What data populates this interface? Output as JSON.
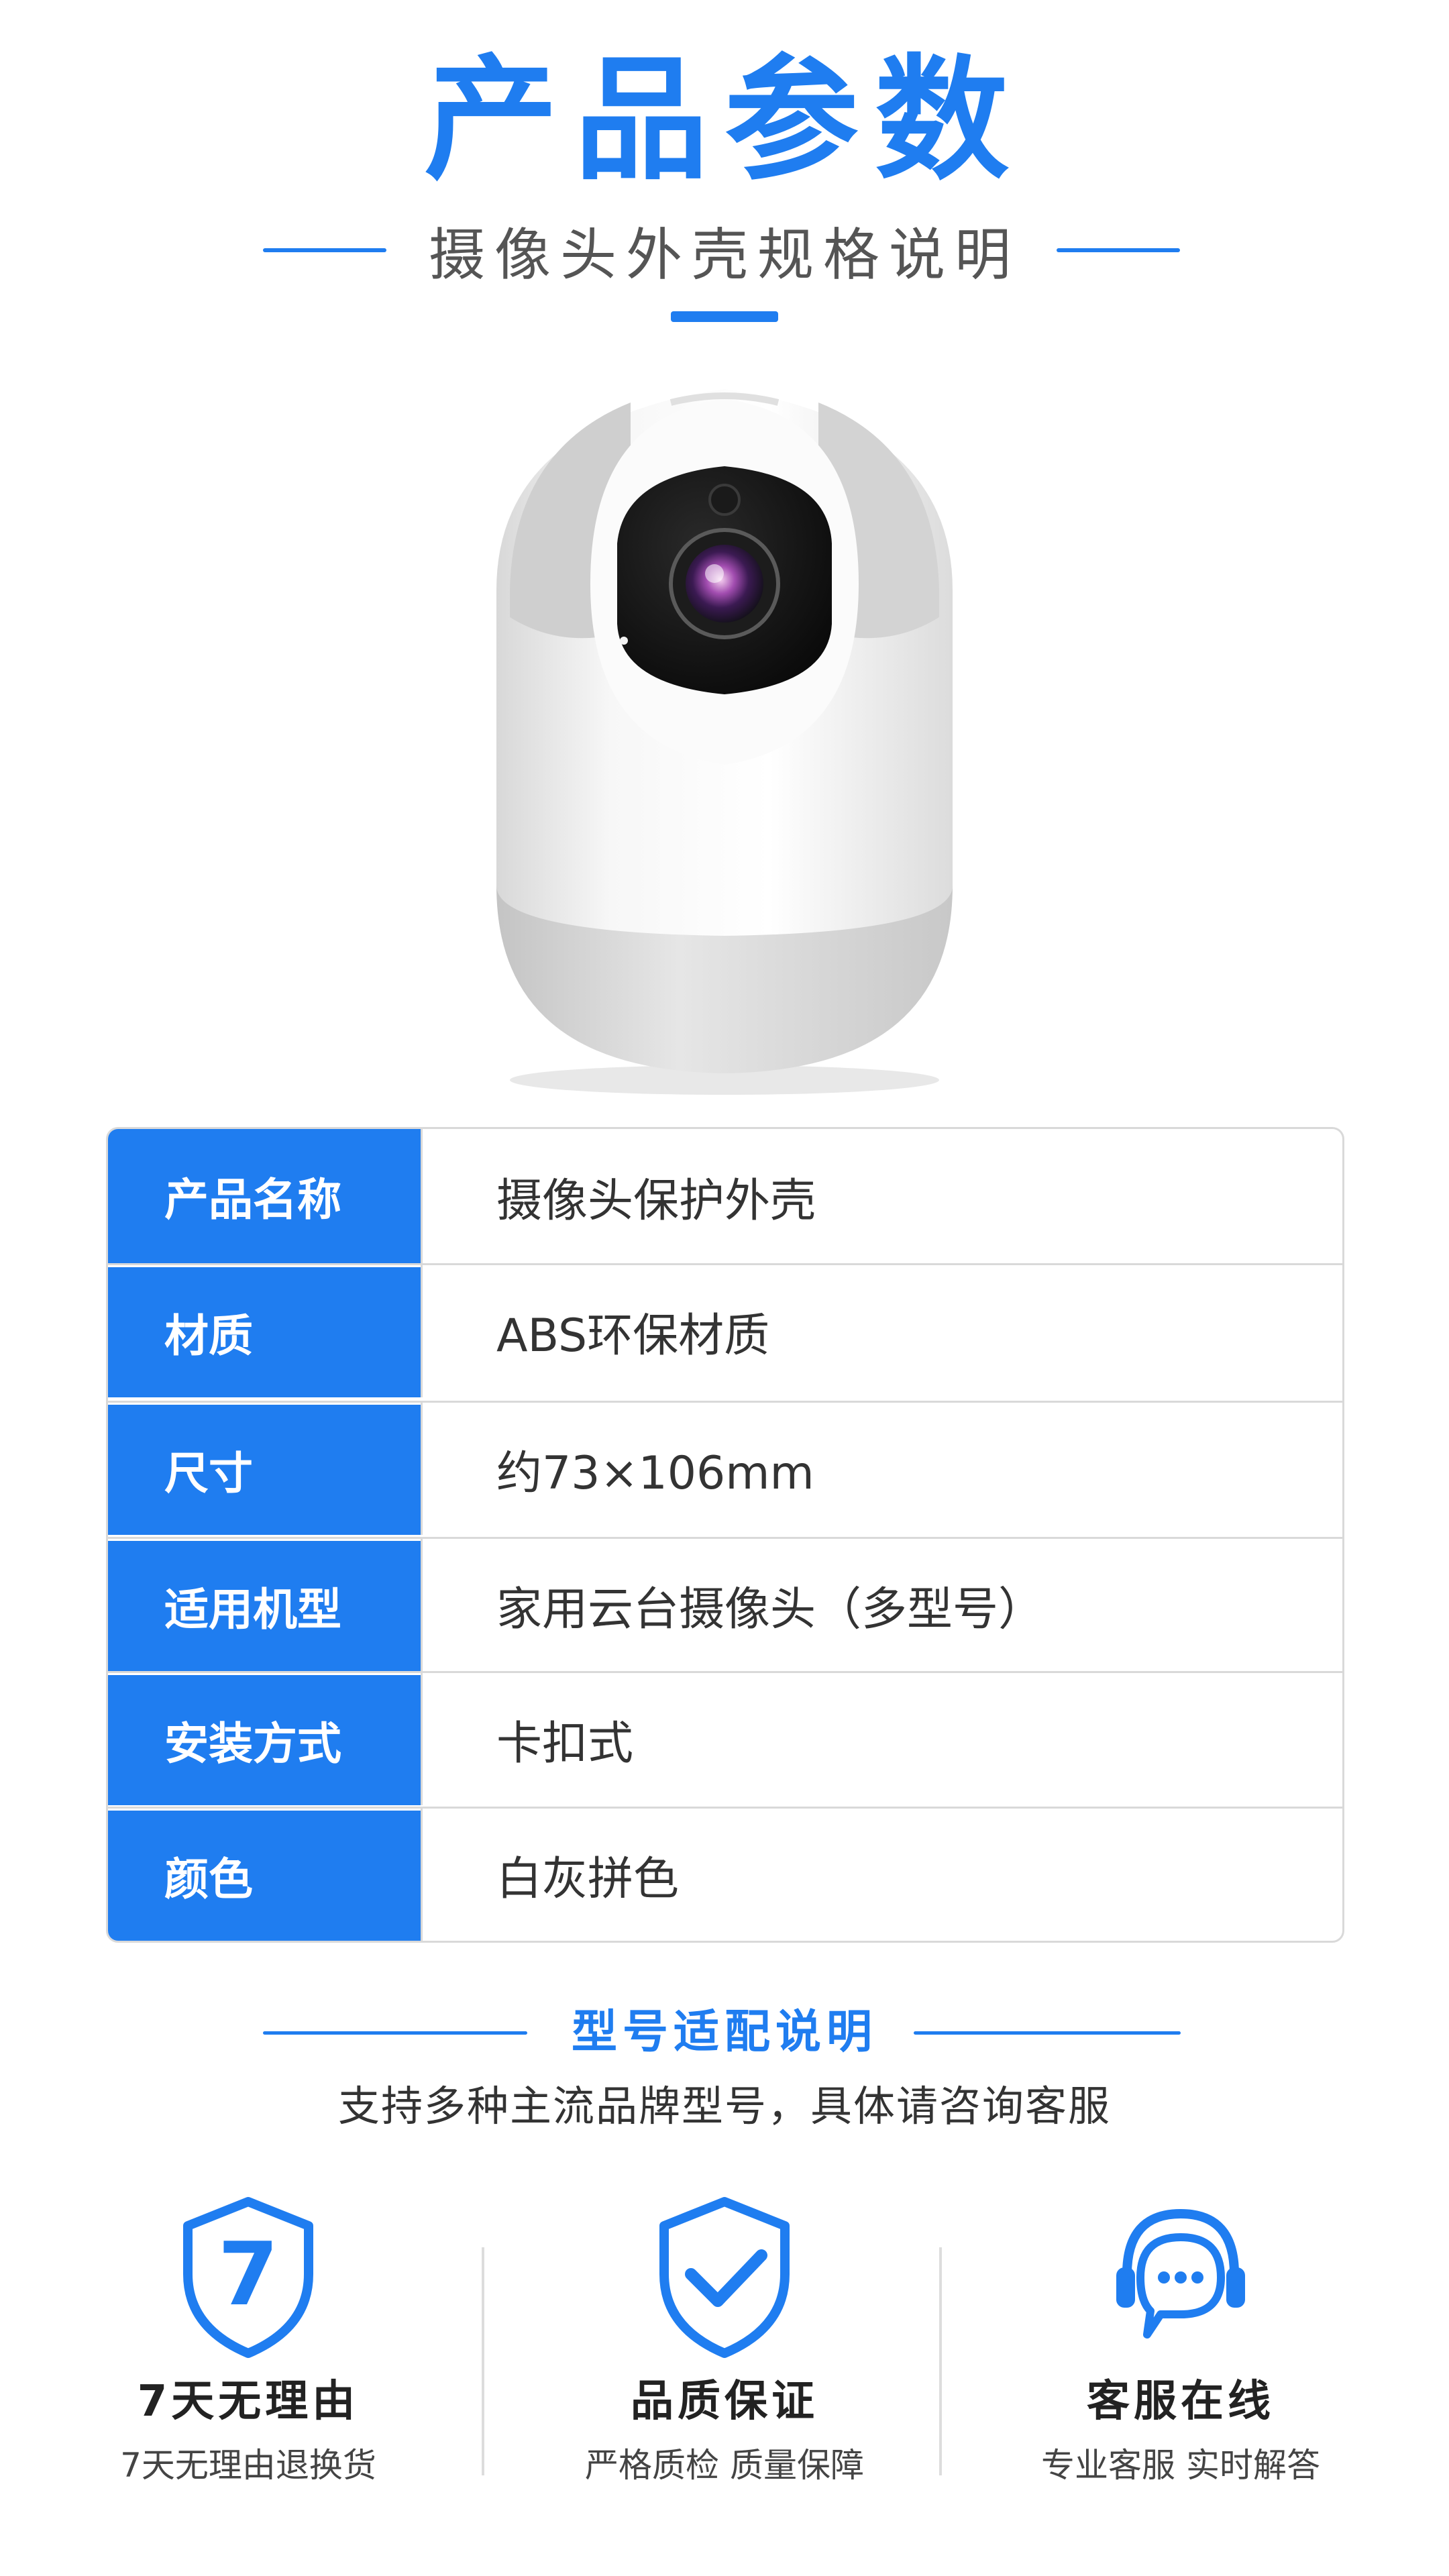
{
  "header": {
    "title": "产品参数",
    "subtitle": "摄像头外壳规格说明"
  },
  "specs": [
    {
      "key": "产品名称",
      "value": "摄像头保护外壳"
    },
    {
      "key": "材质",
      "value": "ABS环保材质"
    },
    {
      "key": "尺寸",
      "value": "约73×106mm"
    },
    {
      "key": "适用机型",
      "value": "家用云台摄像头（多型号）"
    },
    {
      "key": "安装方式",
      "value": "卡扣式"
    },
    {
      "key": "颜色",
      "value": "白灰拼色"
    }
  ],
  "compat": {
    "title": "型号适配说明",
    "description": "支持多种主流品牌型号，具体请咨询客服"
  },
  "features": [
    {
      "icon": "shield-seven-icon",
      "badge": "7",
      "title": "7天无理由",
      "description": "7天无理由退换货"
    },
    {
      "icon": "shield-check-icon",
      "title": "品质保证",
      "description": "严格质检 质量保障"
    },
    {
      "icon": "headset-chat-icon",
      "title": "客服在线",
      "description": "专业客服 实时解答"
    }
  ],
  "colors": {
    "accent": "#1f7df0",
    "text": "#333333",
    "border": "#d9d9d9"
  }
}
